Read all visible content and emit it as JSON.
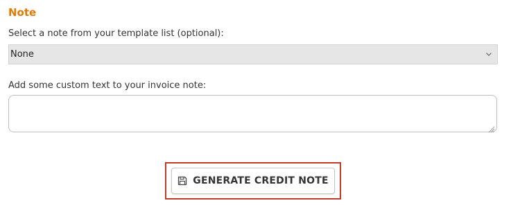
{
  "note_section": {
    "title": "Note",
    "title_color": "#e07a00",
    "template_label": "Select a note from your template list (optional):",
    "template_select": {
      "selected": "None",
      "chevron_icon": "chevron-down-icon"
    },
    "custom_text_label": "Add some custom text to your invoice note:",
    "custom_text_value": ""
  },
  "actions": {
    "generate_label": "GENERATE CREDIT NOTE",
    "generate_icon": "floppy-disk-icon",
    "highlight_color": "#c0392b"
  }
}
